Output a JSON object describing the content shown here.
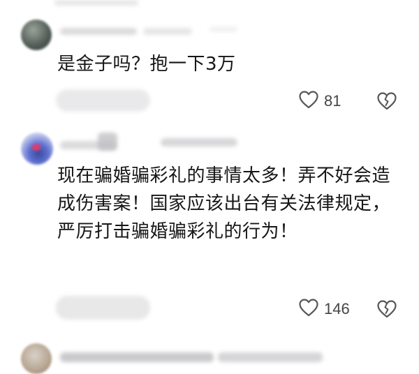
{
  "comments": [
    {
      "text": "是金子吗？抱一下3万",
      "likes": "81"
    },
    {
      "text": "现在骗婚骗彩礼的事情太多！弄不好会造成伤害案！国家应该出台有关法律规定，严厉打击骗婚骗彩礼的行为！",
      "likes": "146"
    }
  ],
  "icons": {
    "like": "heart-outline",
    "dislike": "broken-heart-outline"
  },
  "colors": {
    "text": "#161616",
    "icon": "#555555",
    "background": "#ffffff"
  }
}
